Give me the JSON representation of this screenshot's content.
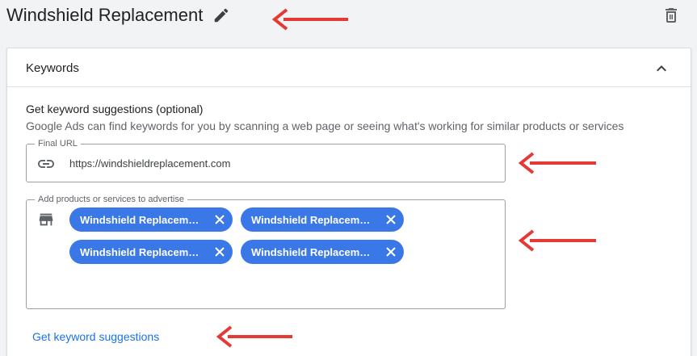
{
  "header": {
    "ad_group_title": "Windshield Replacement"
  },
  "keywords_card": {
    "title": "Keywords",
    "section_heading": "Get keyword suggestions (optional)",
    "section_description": "Google Ads can find keywords for you by scanning a web page or seeing what's working for similar products or services",
    "final_url": {
      "legend": "Final URL",
      "value": "https://windshieldreplacement.com"
    },
    "products": {
      "legend": "Add products or services to advertise",
      "chips": [
        {
          "label": "Windshield Replacement"
        },
        {
          "label": "Windshield Replacement"
        },
        {
          "label": "Windshield Replacement"
        },
        {
          "label": "Windshield Replacement"
        }
      ]
    },
    "suggestions_link": "Get keyword suggestions"
  },
  "colors": {
    "accent": "#1a73e8",
    "chip": "#3b78e7",
    "annotation_arrow": "#e53935"
  }
}
